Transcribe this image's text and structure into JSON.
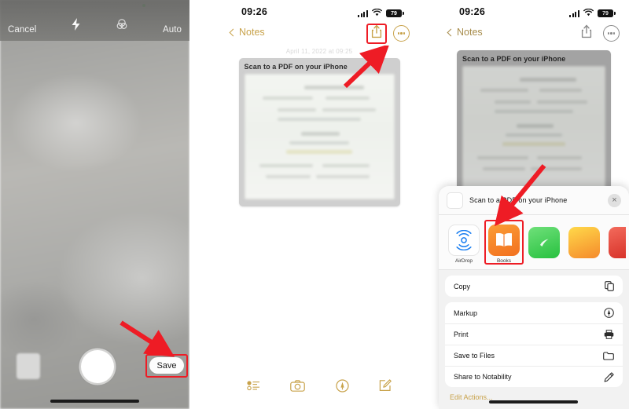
{
  "panels": {
    "camera": {
      "name": "iPhone document scanner camera view",
      "cancel_label": "Cancel",
      "auto_label": "Auto",
      "flash_icon": "flash-bolt-icon",
      "filter_icon": "color-filter-icon",
      "save_label": "Save",
      "shutter_icon": "shutter-button-icon",
      "thumbnail_icon": "last-capture-thumbnail"
    },
    "note": {
      "status": {
        "time": "09:26",
        "battery": "79",
        "cellular_icon": "signal-bars-icon",
        "wifi_icon": "wifi-icon",
        "battery_icon": "battery-icon"
      },
      "nav": {
        "back_label": "Notes",
        "share_icon": "share-icon",
        "more_icon": "more-ellipsis-icon"
      },
      "note_date": "April 11, 2022 at 09:25",
      "note_title": "Scan to a PDF on your iPhone",
      "tabbar": [
        {
          "name": "checklist-icon",
          "label": "Checklist"
        },
        {
          "name": "camera-icon",
          "label": "Camera"
        },
        {
          "name": "markup-pen-icon",
          "label": "Markup"
        },
        {
          "name": "compose-icon",
          "label": "Compose"
        }
      ]
    },
    "share": {
      "status": {
        "time": "09:26",
        "battery": "79"
      },
      "nav": {
        "back_label": "Notes",
        "share_icon": "share-icon",
        "more_icon": "more-ellipsis-icon"
      },
      "note_title": "Scan to a PDF on your iPhone",
      "sheet": {
        "header_title": "Scan to a PDF on your iPhone",
        "app_icon": "notes-app-icon",
        "close_label": "×",
        "apps": [
          {
            "name": "AirDrop",
            "icon": "airdrop-icon",
            "color": "#007aff"
          },
          {
            "name": "Books",
            "icon": "books-icon",
            "color": "#f2701f"
          },
          {
            "name": "",
            "icon": "green-app-icon",
            "color": "#27c13f"
          },
          {
            "name": "",
            "icon": "yellow-app-icon",
            "color": "#f58a2b"
          },
          {
            "name": "",
            "icon": "red-app-icon",
            "color": "#d8332a"
          }
        ],
        "actions_primary": [
          {
            "label": "Copy",
            "icon": "copy-icon"
          }
        ],
        "actions_secondary": [
          {
            "label": "Markup",
            "icon": "markup-icon"
          },
          {
            "label": "Print",
            "icon": "printer-icon"
          },
          {
            "label": "Save to Files",
            "icon": "folder-icon"
          },
          {
            "label": "Share to Notability",
            "icon": "pencil-icon"
          }
        ],
        "edit_actions_label": "Edit Actions..."
      }
    }
  },
  "annotations": {
    "highlight_color": "#ee1c25",
    "arrows": [
      {
        "name": "arrow-to-save-button"
      },
      {
        "name": "arrow-to-share-icon"
      },
      {
        "name": "arrow-to-books-app"
      }
    ]
  }
}
